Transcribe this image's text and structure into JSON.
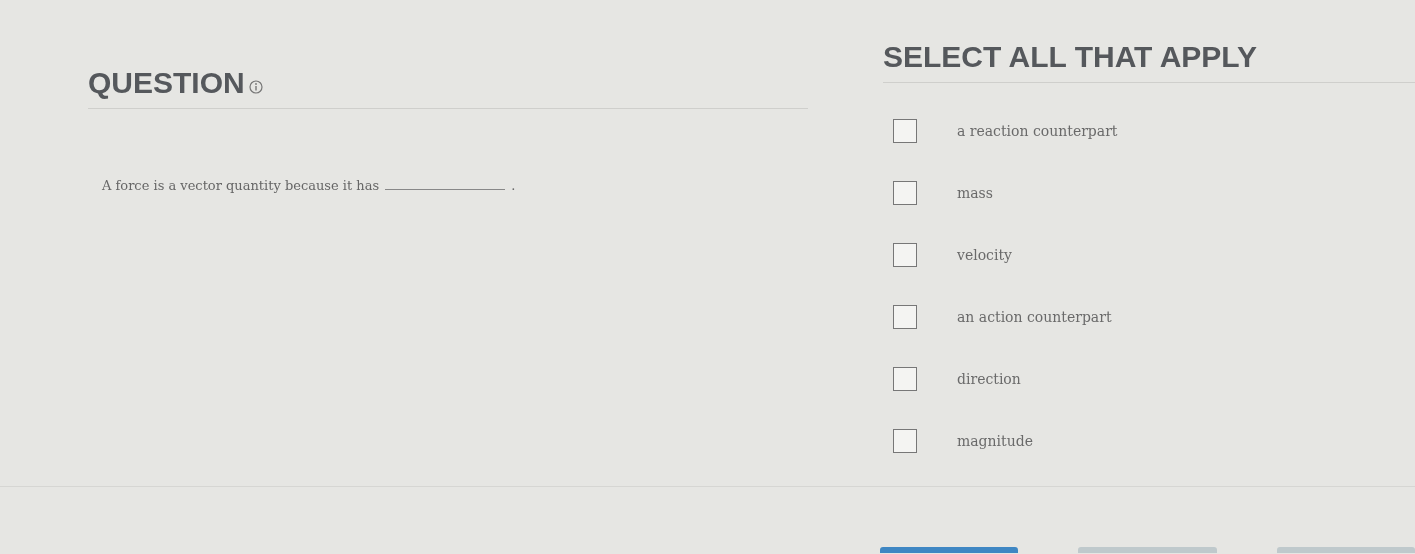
{
  "question": {
    "heading": "QUESTION",
    "text": "A force is a vector quantity because it has",
    "blank_end": "."
  },
  "answers": {
    "heading": "SELECT ALL THAT APPLY",
    "options": [
      {
        "label": "a reaction counterpart",
        "checked": false
      },
      {
        "label": "mass",
        "checked": false
      },
      {
        "label": "velocity",
        "checked": false
      },
      {
        "label": "an action counterpart",
        "checked": false
      },
      {
        "label": "direction",
        "checked": false
      },
      {
        "label": "magnitude",
        "checked": false
      }
    ]
  },
  "footer_buttons": [
    {
      "kind": "primary"
    },
    {
      "kind": "secondary"
    },
    {
      "kind": "secondary"
    }
  ]
}
